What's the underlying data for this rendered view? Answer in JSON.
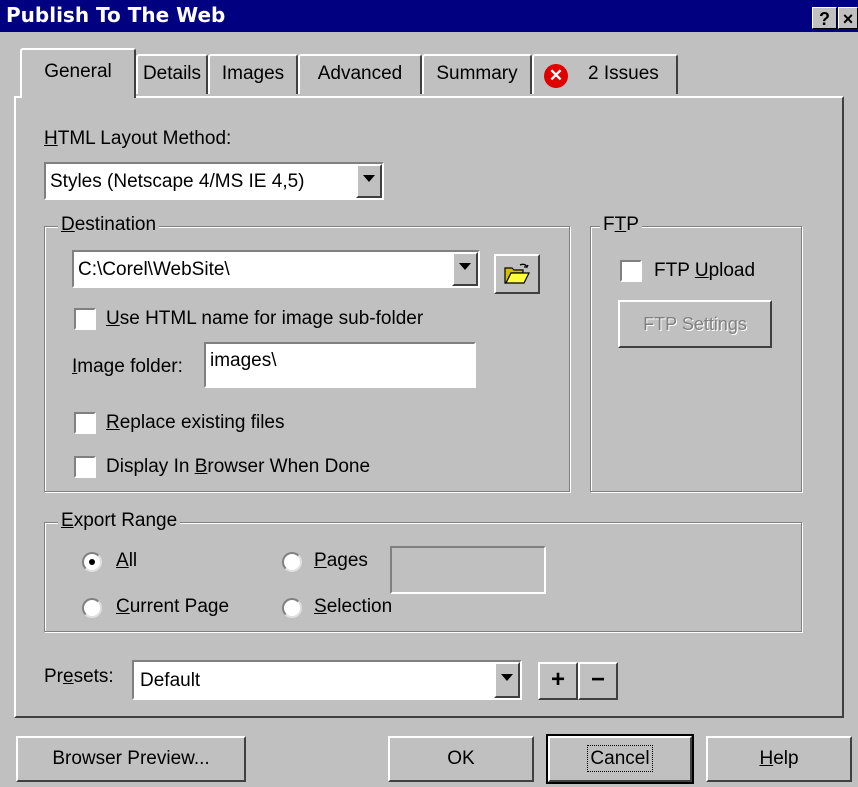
{
  "window": {
    "title": "Publish To The Web",
    "help_button": "?",
    "close_button": "×"
  },
  "tabs": [
    {
      "label": "General"
    },
    {
      "label": "Details"
    },
    {
      "label": "Images"
    },
    {
      "label": "Advanced"
    },
    {
      "label": "Summary"
    },
    {
      "label": "2 Issues",
      "icon": "error-icon"
    }
  ],
  "general": {
    "layout_method": {
      "label_prefix": "",
      "label_mnemonic": "H",
      "label_rest": "TML Layout Method:",
      "value": "Styles (Netscape 4/MS IE 4,5)"
    },
    "destination": {
      "legend_mnemonic": "D",
      "legend_rest": "estination",
      "path": "C:\\Corel\\WebSite\\",
      "use_html_name": {
        "mnemonic": "U",
        "rest": "se HTML name for image sub-folder",
        "checked": false
      },
      "image_folder": {
        "mnemonic": "I",
        "rest": "mage folder:",
        "value": "images\\"
      },
      "replace_existing": {
        "mnemonic": "R",
        "rest": "eplace existing files",
        "checked": false
      },
      "display_in_browser": {
        "prefix": "Display In ",
        "mnemonic": "B",
        "rest": "rowser When Done",
        "checked": false
      }
    },
    "ftp": {
      "legend_prefix": "F",
      "legend_mnemonic": "T",
      "legend_rest": "P",
      "upload": {
        "prefix": "FTP ",
        "mnemonic": "U",
        "rest": "pload",
        "checked": false
      },
      "settings_button": "FTP Settings"
    },
    "export_range": {
      "legend_mnemonic": "E",
      "legend_rest": "xport Range",
      "all": {
        "mnemonic": "A",
        "rest": "ll",
        "selected": true
      },
      "pages": {
        "mnemonic": "P",
        "rest": "ages",
        "selected": false,
        "value": ""
      },
      "current_page": {
        "mnemonic": "C",
        "rest": "urrent Page",
        "selected": false
      },
      "selection": {
        "mnemonic": "S",
        "rest": "election",
        "selected": false
      }
    },
    "presets": {
      "label_prefix": "Pr",
      "label_mnemonic": "e",
      "label_rest": "sets:",
      "value": "Default",
      "add": "+",
      "remove": "−"
    }
  },
  "footer": {
    "browser_preview": "Browser Preview...",
    "ok": "OK",
    "cancel": "Cancel",
    "help_mnemonic": "H",
    "help_rest": "elp"
  }
}
